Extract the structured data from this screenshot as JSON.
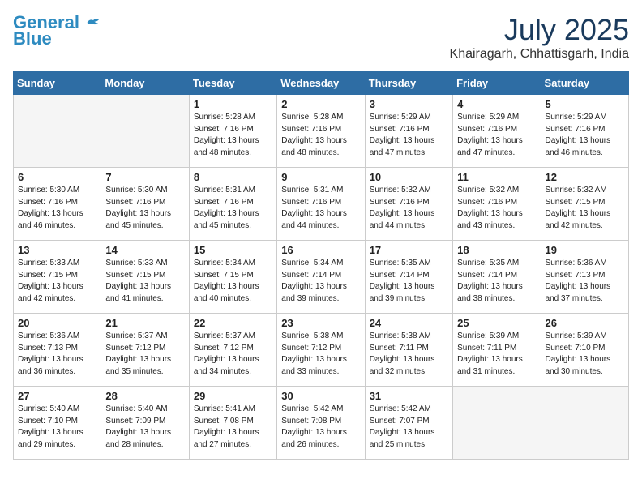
{
  "header": {
    "logo_line1": "General",
    "logo_line2": "Blue",
    "month_year": "July 2025",
    "location": "Khairagarh, Chhattisgarh, India"
  },
  "weekdays": [
    "Sunday",
    "Monday",
    "Tuesday",
    "Wednesday",
    "Thursday",
    "Friday",
    "Saturday"
  ],
  "weeks": [
    [
      {
        "day": "",
        "info": ""
      },
      {
        "day": "",
        "info": ""
      },
      {
        "day": "1",
        "info": "Sunrise: 5:28 AM\nSunset: 7:16 PM\nDaylight: 13 hours and 48 minutes."
      },
      {
        "day": "2",
        "info": "Sunrise: 5:28 AM\nSunset: 7:16 PM\nDaylight: 13 hours and 48 minutes."
      },
      {
        "day": "3",
        "info": "Sunrise: 5:29 AM\nSunset: 7:16 PM\nDaylight: 13 hours and 47 minutes."
      },
      {
        "day": "4",
        "info": "Sunrise: 5:29 AM\nSunset: 7:16 PM\nDaylight: 13 hours and 47 minutes."
      },
      {
        "day": "5",
        "info": "Sunrise: 5:29 AM\nSunset: 7:16 PM\nDaylight: 13 hours and 46 minutes."
      }
    ],
    [
      {
        "day": "6",
        "info": "Sunrise: 5:30 AM\nSunset: 7:16 PM\nDaylight: 13 hours and 46 minutes."
      },
      {
        "day": "7",
        "info": "Sunrise: 5:30 AM\nSunset: 7:16 PM\nDaylight: 13 hours and 45 minutes."
      },
      {
        "day": "8",
        "info": "Sunrise: 5:31 AM\nSunset: 7:16 PM\nDaylight: 13 hours and 45 minutes."
      },
      {
        "day": "9",
        "info": "Sunrise: 5:31 AM\nSunset: 7:16 PM\nDaylight: 13 hours and 44 minutes."
      },
      {
        "day": "10",
        "info": "Sunrise: 5:32 AM\nSunset: 7:16 PM\nDaylight: 13 hours and 44 minutes."
      },
      {
        "day": "11",
        "info": "Sunrise: 5:32 AM\nSunset: 7:16 PM\nDaylight: 13 hours and 43 minutes."
      },
      {
        "day": "12",
        "info": "Sunrise: 5:32 AM\nSunset: 7:15 PM\nDaylight: 13 hours and 42 minutes."
      }
    ],
    [
      {
        "day": "13",
        "info": "Sunrise: 5:33 AM\nSunset: 7:15 PM\nDaylight: 13 hours and 42 minutes."
      },
      {
        "day": "14",
        "info": "Sunrise: 5:33 AM\nSunset: 7:15 PM\nDaylight: 13 hours and 41 minutes."
      },
      {
        "day": "15",
        "info": "Sunrise: 5:34 AM\nSunset: 7:15 PM\nDaylight: 13 hours and 40 minutes."
      },
      {
        "day": "16",
        "info": "Sunrise: 5:34 AM\nSunset: 7:14 PM\nDaylight: 13 hours and 39 minutes."
      },
      {
        "day": "17",
        "info": "Sunrise: 5:35 AM\nSunset: 7:14 PM\nDaylight: 13 hours and 39 minutes."
      },
      {
        "day": "18",
        "info": "Sunrise: 5:35 AM\nSunset: 7:14 PM\nDaylight: 13 hours and 38 minutes."
      },
      {
        "day": "19",
        "info": "Sunrise: 5:36 AM\nSunset: 7:13 PM\nDaylight: 13 hours and 37 minutes."
      }
    ],
    [
      {
        "day": "20",
        "info": "Sunrise: 5:36 AM\nSunset: 7:13 PM\nDaylight: 13 hours and 36 minutes."
      },
      {
        "day": "21",
        "info": "Sunrise: 5:37 AM\nSunset: 7:12 PM\nDaylight: 13 hours and 35 minutes."
      },
      {
        "day": "22",
        "info": "Sunrise: 5:37 AM\nSunset: 7:12 PM\nDaylight: 13 hours and 34 minutes."
      },
      {
        "day": "23",
        "info": "Sunrise: 5:38 AM\nSunset: 7:12 PM\nDaylight: 13 hours and 33 minutes."
      },
      {
        "day": "24",
        "info": "Sunrise: 5:38 AM\nSunset: 7:11 PM\nDaylight: 13 hours and 32 minutes."
      },
      {
        "day": "25",
        "info": "Sunrise: 5:39 AM\nSunset: 7:11 PM\nDaylight: 13 hours and 31 minutes."
      },
      {
        "day": "26",
        "info": "Sunrise: 5:39 AM\nSunset: 7:10 PM\nDaylight: 13 hours and 30 minutes."
      }
    ],
    [
      {
        "day": "27",
        "info": "Sunrise: 5:40 AM\nSunset: 7:10 PM\nDaylight: 13 hours and 29 minutes."
      },
      {
        "day": "28",
        "info": "Sunrise: 5:40 AM\nSunset: 7:09 PM\nDaylight: 13 hours and 28 minutes."
      },
      {
        "day": "29",
        "info": "Sunrise: 5:41 AM\nSunset: 7:08 PM\nDaylight: 13 hours and 27 minutes."
      },
      {
        "day": "30",
        "info": "Sunrise: 5:42 AM\nSunset: 7:08 PM\nDaylight: 13 hours and 26 minutes."
      },
      {
        "day": "31",
        "info": "Sunrise: 5:42 AM\nSunset: 7:07 PM\nDaylight: 13 hours and 25 minutes."
      },
      {
        "day": "",
        "info": ""
      },
      {
        "day": "",
        "info": ""
      }
    ]
  ]
}
